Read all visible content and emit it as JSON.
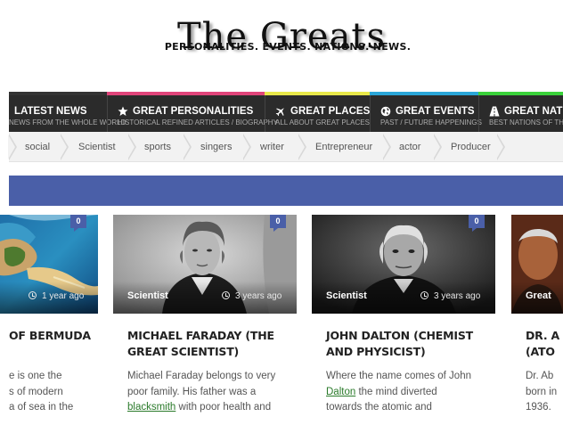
{
  "logo": {
    "title": "The Greats",
    "tagline": "PERSONALITIES. EVENTS. NATIONS. NEWS."
  },
  "nav": [
    {
      "title": "LATEST NEWS",
      "sub": "NEWS FROM THE WHOLE WORLD",
      "icon": "none",
      "color": "#333333"
    },
    {
      "title": "GREAT PERSONALITIES",
      "sub": "HISTORICAL REFINED ARTICLES / BIOGRAPHY",
      "icon": "star-icon",
      "color": "#e0447a"
    },
    {
      "title": "GREAT PLACES",
      "sub": "ALL ABOUT GREAT PLACES",
      "icon": "plane-icon",
      "color": "#e8e84a"
    },
    {
      "title": "GREAT EVENTS",
      "sub": "PAST / FUTURE HAPPENINGS",
      "icon": "globe-icon",
      "color": "#2aa6d8"
    },
    {
      "title": "GREAT NAT",
      "sub": "BEST NATIONS OF TH",
      "icon": "road-icon",
      "color": "#3ad13a"
    }
  ],
  "tags": [
    "social",
    "Scientist",
    "sports",
    "singers",
    "writer",
    "Entrepreneur",
    "actor",
    "Producer"
  ],
  "cards": [
    {
      "category": "",
      "time": "1 year ago",
      "comments": "0",
      "title_lines": [
        "of Bermuda",
        ""
      ],
      "text_lines": [
        "e is one the",
        "s of modern",
        "a of sea in the"
      ],
      "link": ""
    },
    {
      "category": "Scientist",
      "time": "3 years ago",
      "comments": "0",
      "title_lines": [
        "MICHAEL FARADAY (THE",
        "GREAT SCIENTIST)"
      ],
      "text_lines": [
        "Michael Faraday belongs to very",
        "poor family. His father was a",
        " with poor health and"
      ],
      "link": "blacksmith"
    },
    {
      "category": "Scientist",
      "time": "3 years ago",
      "comments": "0",
      "title_lines": [
        "JOHN DALTON (CHEMIST",
        "AND PHYSICIST)"
      ],
      "text_lines": [
        "Where the name comes of John",
        " the mind diverted",
        "towards the atomic and"
      ],
      "link": "Dalton"
    },
    {
      "category": "Great",
      "time": "",
      "comments": "",
      "title_lines": [
        "DR. A",
        "(ATO"
      ],
      "text_lines": [
        "Dr. Ab",
        "born in",
        "1936."
      ],
      "link": ""
    }
  ],
  "colors": {
    "nav_bg": "#2b2b2b",
    "blue_bar": "#4a5fa8",
    "tag_bg": "#f2f2f2",
    "link": "#2a7a2a"
  }
}
